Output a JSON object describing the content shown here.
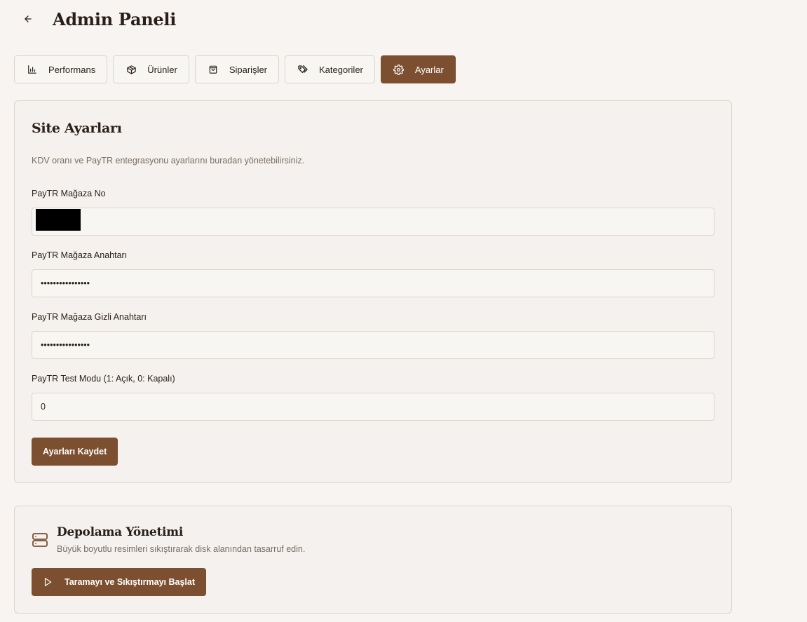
{
  "header": {
    "title": "Admin Paneli"
  },
  "tabs": [
    {
      "label": "Performans",
      "icon": "bar-chart-icon",
      "active": false
    },
    {
      "label": "Ürünler",
      "icon": "package-icon",
      "active": false
    },
    {
      "label": "Siparişler",
      "icon": "shopping-bag-icon",
      "active": false
    },
    {
      "label": "Kategoriler",
      "icon": "tags-icon",
      "active": false
    },
    {
      "label": "Ayarlar",
      "icon": "gear-icon",
      "active": true
    }
  ],
  "settings": {
    "title": "Site Ayarları",
    "description": "KDV oranı ve PayTR entegrasyonu ayarlarını buradan yönetebilirsiniz.",
    "fields": [
      {
        "label": "PayTR Mağaza No",
        "value": ""
      },
      {
        "label": "PayTR Mağaza Anahtarı",
        "value": "••••••••••••••••"
      },
      {
        "label": "PayTR Mağaza Gizli Anahtarı",
        "value": "••••••••••••••••"
      },
      {
        "label": "PayTR Test Modu (1: Açık, 0: Kapalı)",
        "value": "0"
      }
    ],
    "save_label": "Ayarları Kaydet"
  },
  "storage": {
    "title": "Depolama Yönetimi",
    "description": "Büyük boyutlu resimleri sıkıştırarak disk alanından tasarruf edin.",
    "button_label": "Taramayı ve Sıkıştırmayı Başlat"
  },
  "colors": {
    "accent": "#7d4f31",
    "background": "#f7f4f1",
    "card": "#f4f1ee",
    "border": "#ddd5cd"
  }
}
